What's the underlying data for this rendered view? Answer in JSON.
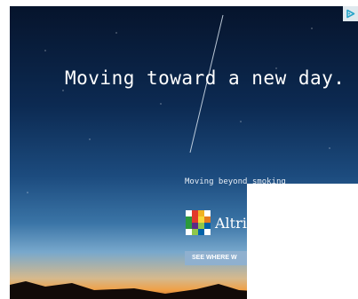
{
  "ad": {
    "headline": "Moving toward a new day.",
    "subline": "Moving beyond smoking",
    "brand": "Altria",
    "cta_label": "SEE WHERE W"
  },
  "logo_colors": [
    "#ffffff",
    "#e23a2a",
    "#f0b323",
    "#ffffff",
    "#2b9a3c",
    "#e23a2a",
    "#f6d93a",
    "#e57a20",
    "#2b9a3c",
    "#5a2c87",
    "#8fc64a",
    "#0061a8",
    "#ffffff",
    "#8fc64a",
    "#0061a8",
    "#ffffff"
  ],
  "colors": {
    "sky_top": "#06142c",
    "horizon": "#f0a046",
    "cta_bg": "#8fb0cf",
    "adchoices_accent": "#26a4c9"
  },
  "icons": {
    "adchoices": "adchoices-icon",
    "brand_logo": "altria-logo-mark"
  }
}
